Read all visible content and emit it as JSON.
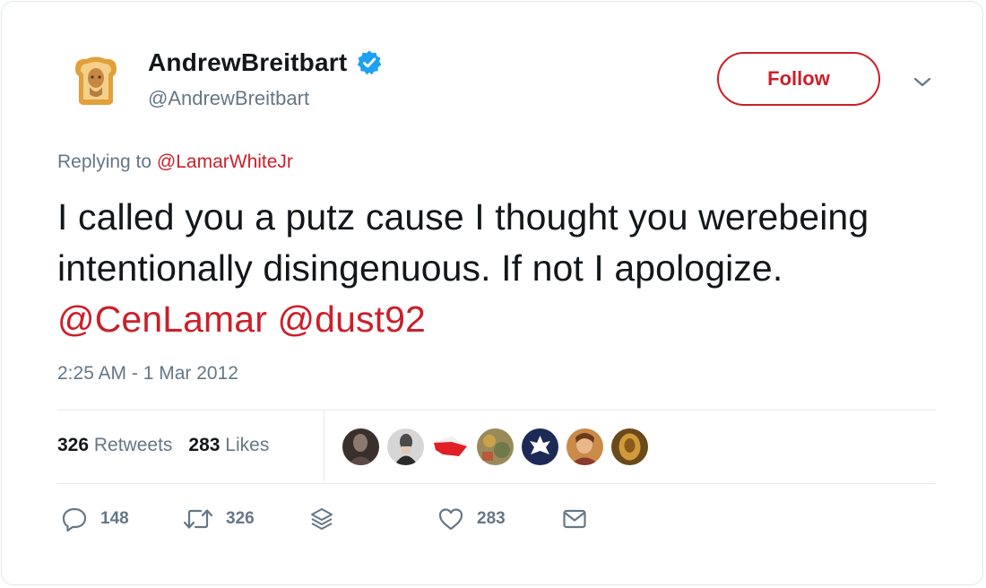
{
  "author": {
    "display_name": "AndrewBreitbart",
    "handle": "@AndrewBreitbart",
    "verified": true
  },
  "header": {
    "follow_label": "Follow"
  },
  "reply": {
    "prefix": "Replying to ",
    "mention": "@LamarWhiteJr"
  },
  "tweet": {
    "text_before": "I called you a putz cause I thought you werebeing intentionally disingenuous. If not I apologize. ",
    "mention_1": "@CenLamar",
    "separator": " ",
    "mention_2": "@dust92"
  },
  "timestamp": "2:25 AM - 1 Mar 2012",
  "stats": {
    "retweets_count": "326",
    "retweets_label": " Retweets",
    "likes_count": "283",
    "likes_label": " Likes"
  },
  "actions": {
    "reply_count": "148",
    "retweet_count": "326",
    "like_count": "283"
  },
  "colors": {
    "accent": "#cc1f2a",
    "verified": "#1da1f2",
    "muted": "#657786",
    "text": "#14171a"
  },
  "icons": [
    "verified-icon",
    "chevron-down-icon",
    "reply-icon",
    "retweet-icon",
    "stack-icon",
    "heart-icon",
    "mail-icon"
  ]
}
